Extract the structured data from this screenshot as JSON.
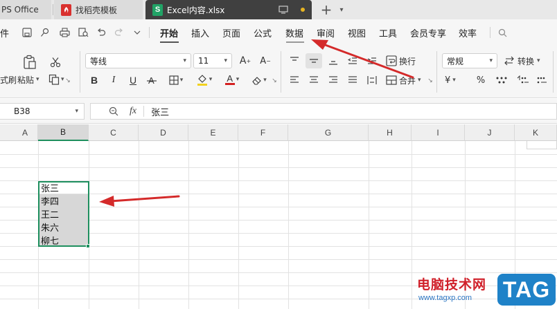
{
  "tabs": [
    {
      "label": "PS Office"
    },
    {
      "label": "找稻壳模板",
      "icon": "daoke-icon"
    },
    {
      "label": "Excel内容.xlsx",
      "icon": "spreadsheet-icon",
      "icon_letter": "S",
      "active": true
    }
  ],
  "new_tab_symbol": "+",
  "menubar": {
    "file_label": "件",
    "items": [
      {
        "label": "开始",
        "active": true
      },
      {
        "label": "插入"
      },
      {
        "label": "页面"
      },
      {
        "label": "公式"
      },
      {
        "label": "数据"
      },
      {
        "label": "审阅"
      },
      {
        "label": "视图"
      },
      {
        "label": "工具"
      },
      {
        "label": "会员专享"
      },
      {
        "label": "效率"
      }
    ]
  },
  "ribbon": {
    "format_painter": "式刷",
    "paste": "粘贴",
    "font_name": "等线",
    "font_size": "11",
    "wrap_text": "换行",
    "merge": "合并",
    "number_format": "常规",
    "convert": "转换",
    "bold": "B",
    "italic": "I",
    "underline": "U",
    "font_color_letter": "A",
    "currency": "¥",
    "percent": "%",
    "highlight_color": "#f2d21f",
    "font_color": "#d42121"
  },
  "formula_bar": {
    "cell_ref": "B38",
    "fx": "fx",
    "value": "张三"
  },
  "columns": [
    "A",
    "B",
    "C",
    "D",
    "E",
    "F",
    "G",
    "H",
    "I",
    "J",
    "K"
  ],
  "active_column": "B",
  "cells": [
    {
      "value": "张三",
      "shaded": false
    },
    {
      "value": "李四",
      "shaded": true
    },
    {
      "value": "王二",
      "shaded": true
    },
    {
      "value": "朱六",
      "shaded": true
    },
    {
      "value": "柳七",
      "shaded": true
    }
  ],
  "colors": {
    "selection": "#1e8f5e",
    "annotation_arrow": "#d42a2a"
  },
  "watermark": {
    "text": "电脑技术网",
    "url": "www.tagxp.com",
    "badge": "TAG"
  }
}
